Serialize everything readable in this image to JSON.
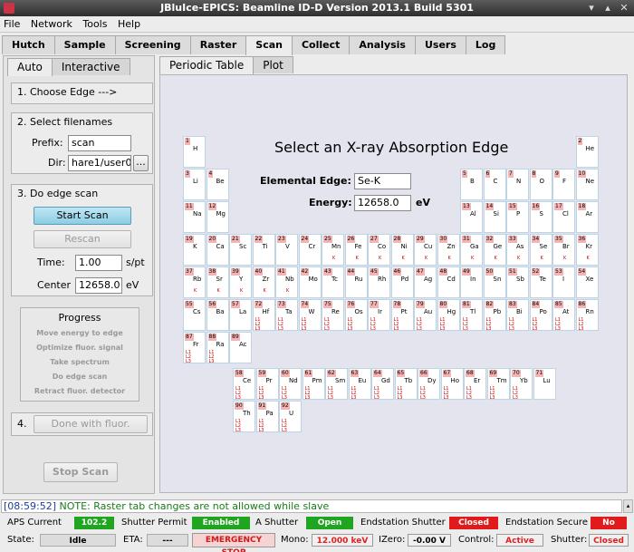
{
  "window": {
    "title": "JBluIce-EPICS: Beamline ID-D Version 2013.1 Build 5301"
  },
  "menu": [
    "File",
    "Network",
    "Tools",
    "Help"
  ],
  "main_tabs": [
    "Hutch",
    "Sample",
    "Screening",
    "Raster",
    "Scan",
    "Collect",
    "Analysis",
    "Users",
    "Log"
  ],
  "left": {
    "tabs": [
      "Auto",
      "Interactive"
    ],
    "step1": "1.  Choose Edge --->",
    "step2": "2.  Select filenames",
    "prefix_label": "Prefix:",
    "prefix_value": "scan",
    "dir_label": "Dir:",
    "dir_value": "hare1/user0",
    "browse_label": "...",
    "step3": "3.  Do edge scan",
    "start_scan": "Start Scan",
    "rescan": "Rescan",
    "time_label": "Time:",
    "time_value": "1.00",
    "time_unit": "s/pt",
    "center_label": "Center",
    "center_value": "12658.0",
    "center_unit": "eV",
    "progress_title": "Progress",
    "progress_steps": [
      "Move energy to edge",
      "Optimize fluor. signal",
      "Take spectrum",
      "Do edge scan",
      "Retract fluor. detector"
    ],
    "step4": "4.",
    "done_button": "Done with fluor.",
    "stop_scan": "Stop Scan"
  },
  "right": {
    "tabs": [
      "Periodic Table",
      "Plot"
    ],
    "title": "Select an X-ray Absorption Edge",
    "edge_label": "Elemental Edge:",
    "edge_value": "Se-K",
    "energy_label": "Energy:",
    "energy_value": "12658.0",
    "energy_unit": "eV"
  },
  "elements": [
    {
      "n": "1",
      "s": "H",
      "e": ""
    },
    {
      "n": "2",
      "s": "He",
      "e": ""
    },
    {
      "n": "3",
      "s": "Li",
      "e": ""
    },
    {
      "n": "4",
      "s": "Be",
      "e": ""
    },
    {
      "n": "5",
      "s": "B",
      "e": ""
    },
    {
      "n": "6",
      "s": "C",
      "e": ""
    },
    {
      "n": "7",
      "s": "N",
      "e": ""
    },
    {
      "n": "8",
      "s": "O",
      "e": ""
    },
    {
      "n": "9",
      "s": "F",
      "e": ""
    },
    {
      "n": "10",
      "s": "Ne",
      "e": ""
    },
    {
      "n": "11",
      "s": "Na",
      "e": ""
    },
    {
      "n": "12",
      "s": "Mg",
      "e": ""
    },
    {
      "n": "13",
      "s": "Al",
      "e": ""
    },
    {
      "n": "14",
      "s": "Si",
      "e": ""
    },
    {
      "n": "15",
      "s": "P",
      "e": ""
    },
    {
      "n": "16",
      "s": "S",
      "e": ""
    },
    {
      "n": "17",
      "s": "Cl",
      "e": ""
    },
    {
      "n": "18",
      "s": "Ar",
      "e": ""
    },
    {
      "n": "19",
      "s": "K",
      "e": ""
    },
    {
      "n": "20",
      "s": "Ca",
      "e": ""
    },
    {
      "n": "21",
      "s": "Sc",
      "e": ""
    },
    {
      "n": "22",
      "s": "Ti",
      "e": ""
    },
    {
      "n": "23",
      "s": "V",
      "e": ""
    },
    {
      "n": "24",
      "s": "Cr",
      "e": ""
    },
    {
      "n": "25",
      "s": "Mn",
      "e": "K"
    },
    {
      "n": "26",
      "s": "Fe",
      "e": "K"
    },
    {
      "n": "27",
      "s": "Co",
      "e": "K"
    },
    {
      "n": "28",
      "s": "Ni",
      "e": "K"
    },
    {
      "n": "29",
      "s": "Cu",
      "e": "K"
    },
    {
      "n": "30",
      "s": "Zn",
      "e": "K"
    },
    {
      "n": "31",
      "s": "Ga",
      "e": "K"
    },
    {
      "n": "32",
      "s": "Ge",
      "e": "K"
    },
    {
      "n": "33",
      "s": "As",
      "e": "K"
    },
    {
      "n": "34",
      "s": "Se",
      "e": "K"
    },
    {
      "n": "35",
      "s": "Br",
      "e": "K"
    },
    {
      "n": "36",
      "s": "Kr",
      "e": "K"
    },
    {
      "n": "37",
      "s": "Rb",
      "e": "K"
    },
    {
      "n": "38",
      "s": "Sr",
      "e": "K"
    },
    {
      "n": "39",
      "s": "Y",
      "e": "K"
    },
    {
      "n": "40",
      "s": "Zr",
      "e": "K"
    },
    {
      "n": "41",
      "s": "Nb",
      "e": "K"
    },
    {
      "n": "42",
      "s": "Mo",
      "e": ""
    },
    {
      "n": "43",
      "s": "Tc",
      "e": ""
    },
    {
      "n": "44",
      "s": "Ru",
      "e": ""
    },
    {
      "n": "45",
      "s": "Rh",
      "e": ""
    },
    {
      "n": "46",
      "s": "Pd",
      "e": ""
    },
    {
      "n": "47",
      "s": "Ag",
      "e": ""
    },
    {
      "n": "48",
      "s": "Cd",
      "e": ""
    },
    {
      "n": "49",
      "s": "In",
      "e": ""
    },
    {
      "n": "50",
      "s": "Sn",
      "e": ""
    },
    {
      "n": "51",
      "s": "Sb",
      "e": ""
    },
    {
      "n": "52",
      "s": "Te",
      "e": ""
    },
    {
      "n": "53",
      "s": "I",
      "e": ""
    },
    {
      "n": "54",
      "s": "Xe",
      "e": ""
    },
    {
      "n": "55",
      "s": "Cs",
      "e": ""
    },
    {
      "n": "56",
      "s": "Ba",
      "e": ""
    },
    {
      "n": "57",
      "s": "La",
      "e": ""
    },
    {
      "n": "72",
      "s": "Hf",
      "e": "L1 L2 L3"
    },
    {
      "n": "73",
      "s": "Ta",
      "e": "L1 L2 L3"
    },
    {
      "n": "74",
      "s": "W",
      "e": "L1 L2 L3"
    },
    {
      "n": "75",
      "s": "Re",
      "e": "L1 L2 L3"
    },
    {
      "n": "76",
      "s": "Os",
      "e": "L1 L2 L3"
    },
    {
      "n": "77",
      "s": "Ir",
      "e": "L1 L2 L3"
    },
    {
      "n": "78",
      "s": "Pt",
      "e": "L1 L2 L3"
    },
    {
      "n": "79",
      "s": "Au",
      "e": "L1 L2 L3"
    },
    {
      "n": "80",
      "s": "Hg",
      "e": "L1 L2 L3"
    },
    {
      "n": "81",
      "s": "Tl",
      "e": "L1 L2 L3"
    },
    {
      "n": "82",
      "s": "Pb",
      "e": "L1 L2 L3"
    },
    {
      "n": "83",
      "s": "Bi",
      "e": "L1 L2 L3"
    },
    {
      "n": "84",
      "s": "Po",
      "e": "L1 L2 L3"
    },
    {
      "n": "85",
      "s": "At",
      "e": "L1 L2 L3"
    },
    {
      "n": "86",
      "s": "Rn",
      "e": "L1 L2 L3"
    },
    {
      "n": "87",
      "s": "Fr",
      "e": "L1 L2 L3"
    },
    {
      "n": "88",
      "s": "Ra",
      "e": "L1 L2 L3"
    },
    {
      "n": "89",
      "s": "Ac",
      "e": ""
    },
    {
      "n": "58",
      "s": "Ce",
      "e": "L1 L2 L3"
    },
    {
      "n": "59",
      "s": "Pr",
      "e": "L1 L2 L3"
    },
    {
      "n": "60",
      "s": "Nd",
      "e": "L1 L2 L3"
    },
    {
      "n": "61",
      "s": "Pm",
      "e": "L1 L2 L3"
    },
    {
      "n": "62",
      "s": "Sm",
      "e": "L1 L2 L3"
    },
    {
      "n": "63",
      "s": "Eu",
      "e": "L1 L2 L3"
    },
    {
      "n": "64",
      "s": "Gd",
      "e": "L1 L2 L3"
    },
    {
      "n": "65",
      "s": "Tb",
      "e": "L1 L2 L3"
    },
    {
      "n": "66",
      "s": "Dy",
      "e": "L1 L2 L3"
    },
    {
      "n": "67",
      "s": "Ho",
      "e": "L1 L2 L3"
    },
    {
      "n": "68",
      "s": "Er",
      "e": "L1 L2 L3"
    },
    {
      "n": "69",
      "s": "Tm",
      "e": "L1 L2 L3"
    },
    {
      "n": "70",
      "s": "Yb",
      "e": "L1 L2 L3"
    },
    {
      "n": "71",
      "s": "Lu",
      "e": ""
    },
    {
      "n": "90",
      "s": "Th",
      "e": "L1 L2 L3"
    },
    {
      "n": "91",
      "s": "Pa",
      "e": "L1 L2 L3"
    },
    {
      "n": "92",
      "s": "U",
      "e": "L1 L2 L3"
    }
  ],
  "log": {
    "timestamp": "[08:59:52]",
    "message": "NOTE: Raster tab changes are not allowed while slave"
  },
  "status": {
    "aps_label": "APS Current",
    "aps_value": "102.2",
    "shutter_permit_label": "Shutter Permit",
    "shutter_permit_value": "Enabled",
    "a_shutter_label": "A Shutter",
    "a_shutter_value": "Open",
    "endstation_shutter_label": "Endstation Shutter",
    "endstation_shutter_value": "Closed",
    "endstation_secure_label": "Endstation Secure",
    "endstation_secure_value": "No",
    "state_label": "State:",
    "state_value": "Idle",
    "eta_label": "ETA:",
    "eta_value": "---",
    "emergency_label": "EMERGENCY STOP",
    "mono_label": "Mono:",
    "mono_value": "12.000 keV",
    "izero_label": "IZero:",
    "izero_value": "-0.00 V",
    "control_label": "Control:",
    "control_value": "Active",
    "shutter_label": "Shutter:",
    "shutter_value": "Closed"
  }
}
